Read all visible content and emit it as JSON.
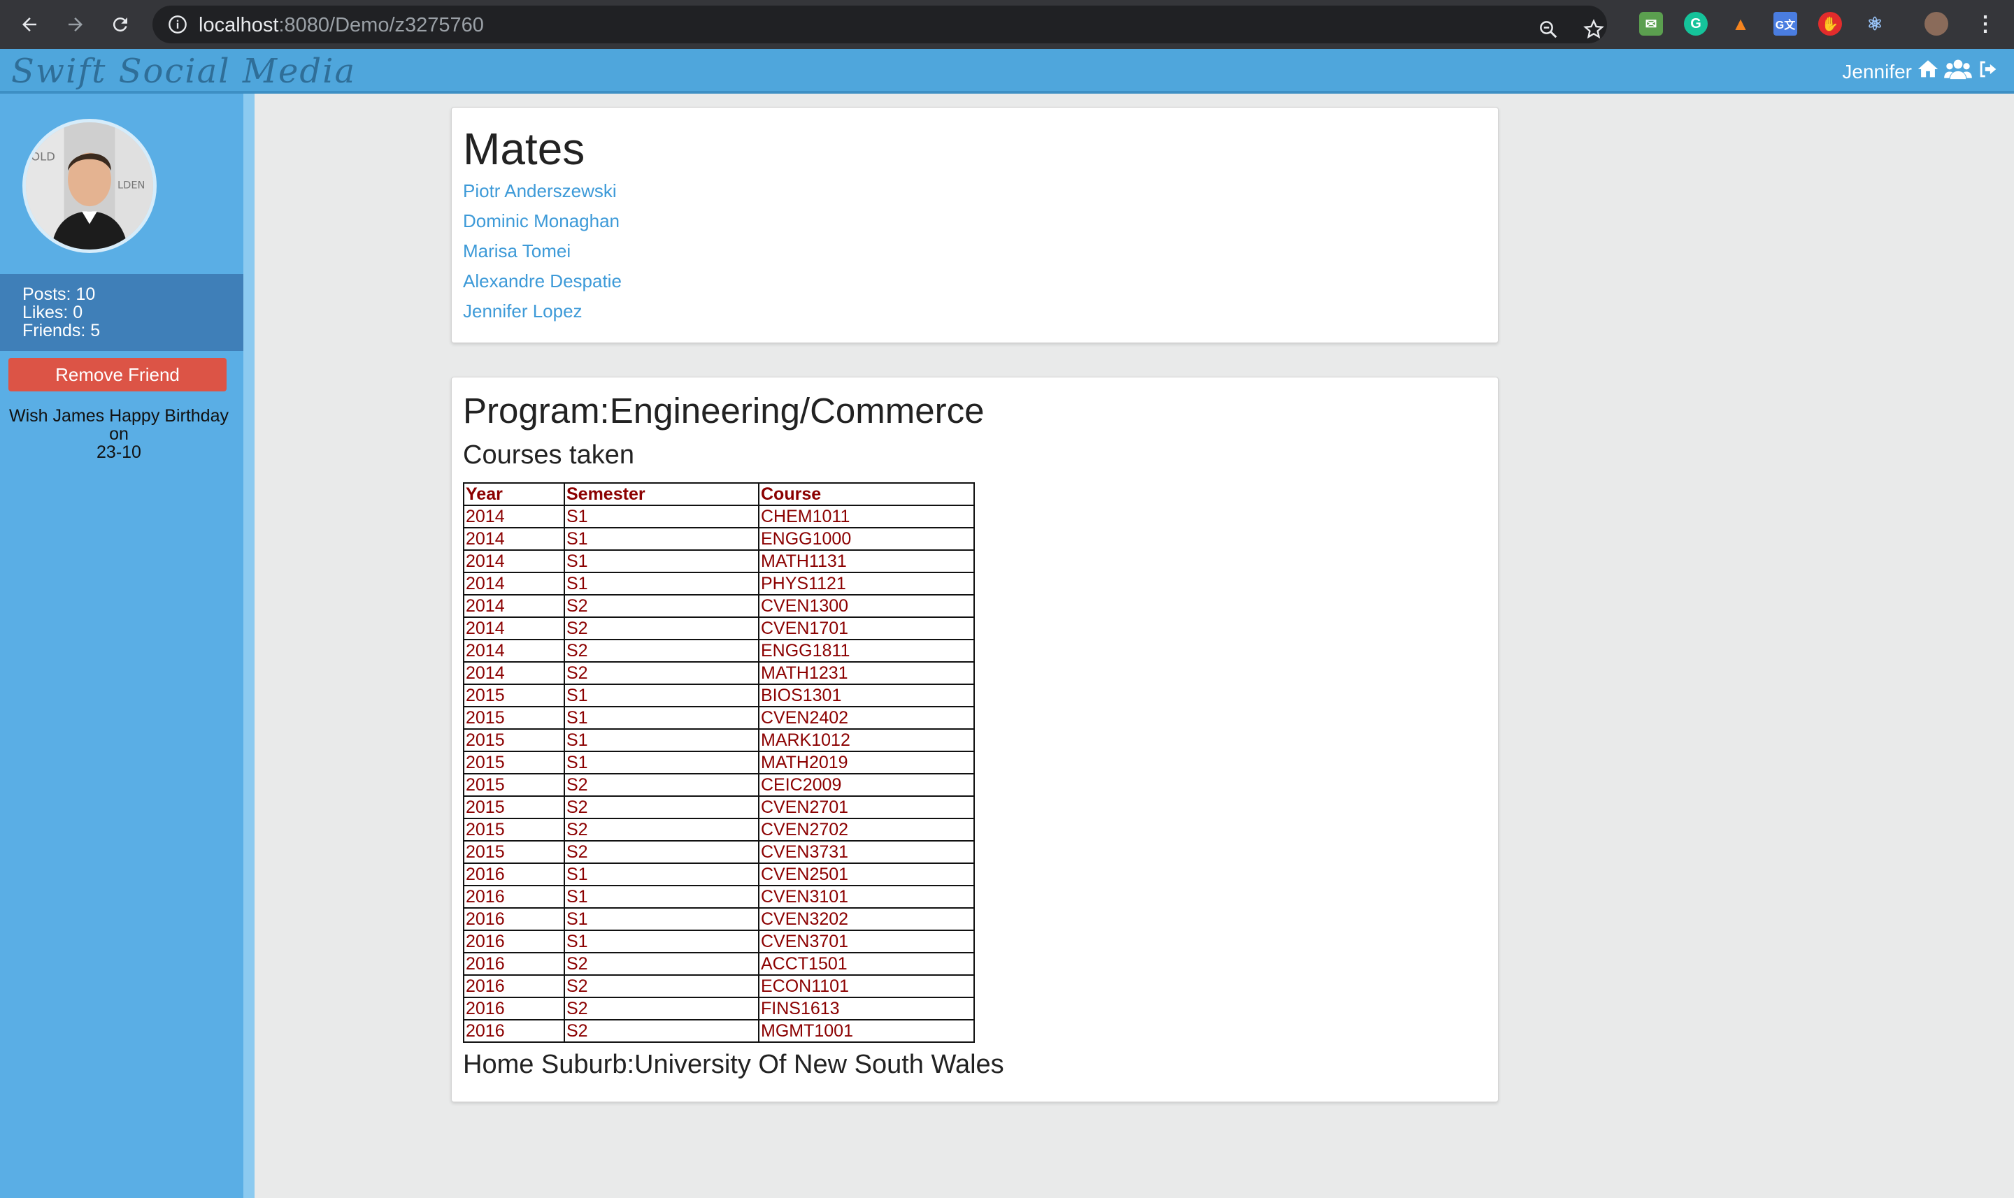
{
  "browser": {
    "url_host": "localhost",
    "url_rest": ":8080/Demo/z3275760",
    "icons": [
      "back-icon",
      "forward-icon",
      "reload-icon",
      "info-icon",
      "zoom-icon",
      "star-icon",
      "menu-icon"
    ]
  },
  "header": {
    "brand": "Swift Social Media",
    "user_name": "Jennifer",
    "icons": [
      "home-icon",
      "friends-icon",
      "logout-icon"
    ],
    "accent": "#4fa6dc"
  },
  "sidebar": {
    "posts": "Posts: 10",
    "likes": "Likes: 0",
    "friends": "Friends: 5",
    "remove_button": "Remove Friend",
    "birthday_line1": "Wish James Happy Birthday",
    "birthday_line2": "on",
    "birthday_line3": "23-10"
  },
  "mates": {
    "title": "Mates",
    "list": [
      "Piotr Anderszewski",
      "Dominic Monaghan",
      "Marisa Tomei",
      "Alexandre Despatie",
      "Jennifer Lopez"
    ]
  },
  "program": {
    "title": "Program:Engineering/Commerce",
    "courses_title": "Courses taken",
    "columns": [
      "Year",
      "Semester",
      "Course"
    ],
    "rows": [
      [
        "2014",
        "S1",
        "CHEM1011"
      ],
      [
        "2014",
        "S1",
        "ENGG1000"
      ],
      [
        "2014",
        "S1",
        "MATH1131"
      ],
      [
        "2014",
        "S1",
        "PHYS1121"
      ],
      [
        "2014",
        "S2",
        "CVEN1300"
      ],
      [
        "2014",
        "S2",
        "CVEN1701"
      ],
      [
        "2014",
        "S2",
        "ENGG1811"
      ],
      [
        "2014",
        "S2",
        "MATH1231"
      ],
      [
        "2015",
        "S1",
        "BIOS1301"
      ],
      [
        "2015",
        "S1",
        "CVEN2402"
      ],
      [
        "2015",
        "S1",
        "MARK1012"
      ],
      [
        "2015",
        "S1",
        "MATH2019"
      ],
      [
        "2015",
        "S2",
        "CEIC2009"
      ],
      [
        "2015",
        "S2",
        "CVEN2701"
      ],
      [
        "2015",
        "S2",
        "CVEN2702"
      ],
      [
        "2015",
        "S2",
        "CVEN3731"
      ],
      [
        "2016",
        "S1",
        "CVEN2501"
      ],
      [
        "2016",
        "S1",
        "CVEN3101"
      ],
      [
        "2016",
        "S1",
        "CVEN3202"
      ],
      [
        "2016",
        "S1",
        "CVEN3701"
      ],
      [
        "2016",
        "S2",
        "ACCT1501"
      ],
      [
        "2016",
        "S2",
        "ECON1101"
      ],
      [
        "2016",
        "S2",
        "FINS1613"
      ],
      [
        "2016",
        "S2",
        "MGMT1001"
      ]
    ],
    "suburb": "Home Suburb:University Of New South Wales"
  }
}
